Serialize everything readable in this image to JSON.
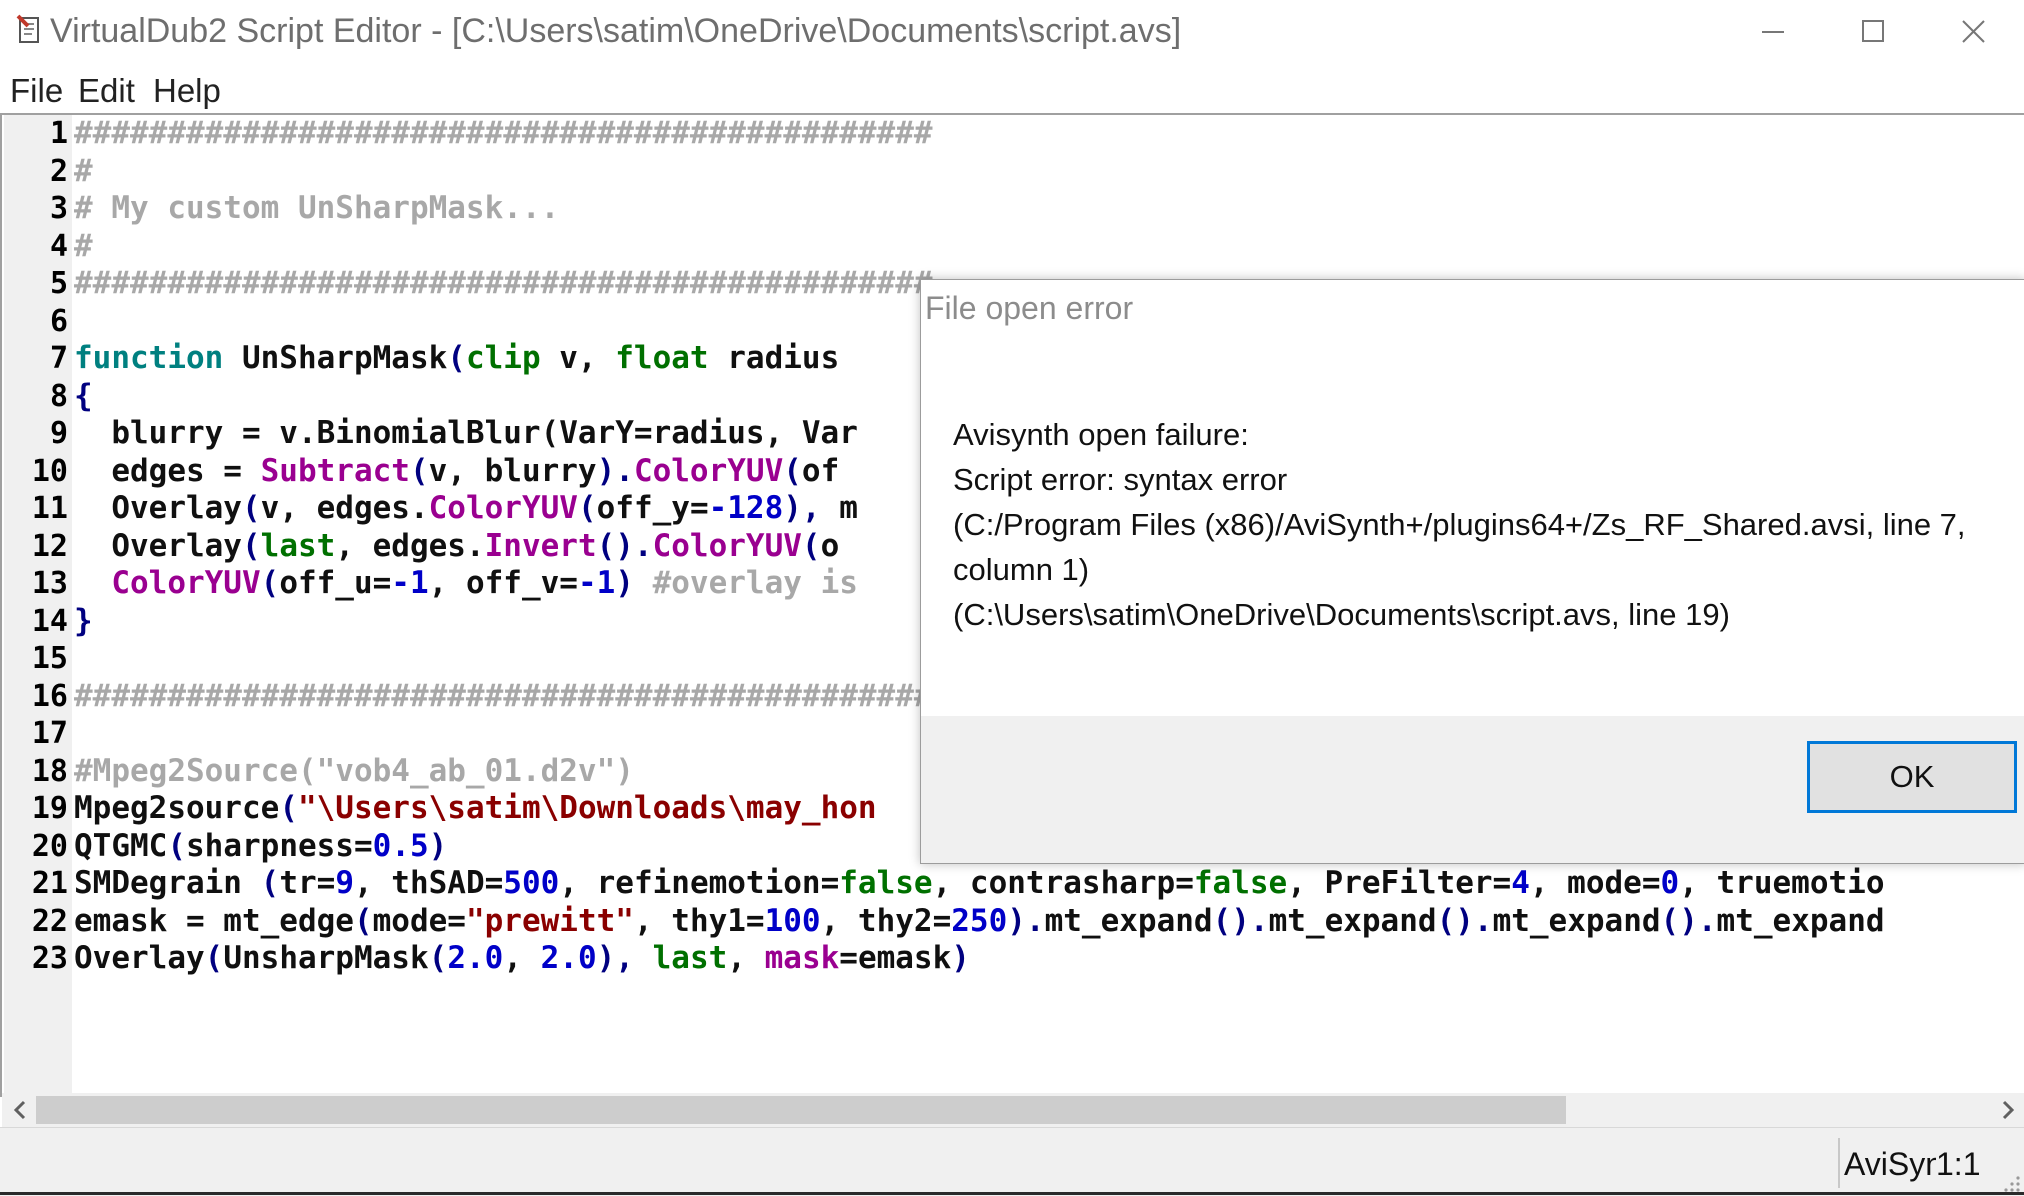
{
  "window": {
    "title": "VirtualDub2 Script Editor - [C:\\Users\\satim\\OneDrive\\Documents\\script.avs]"
  },
  "menu": {
    "items": [
      "File",
      "Edit",
      "Help"
    ]
  },
  "editor": {
    "lines": [
      {
        "n": "1",
        "tokens": [
          {
            "c": "com",
            "t": "##############################################"
          }
        ]
      },
      {
        "n": "2",
        "tokens": [
          {
            "c": "com",
            "t": "#"
          }
        ]
      },
      {
        "n": "3",
        "tokens": [
          {
            "c": "com",
            "t": "# My custom UnSharpMask..."
          }
        ]
      },
      {
        "n": "4",
        "tokens": [
          {
            "c": "com",
            "t": "#"
          }
        ]
      },
      {
        "n": "5",
        "tokens": [
          {
            "c": "com",
            "t": "##############################################"
          }
        ]
      },
      {
        "n": "6",
        "tokens": []
      },
      {
        "n": "7",
        "tokens": [
          {
            "c": "fn",
            "t": "function"
          },
          {
            "c": "pl",
            "t": " UnSharpMask"
          },
          {
            "c": "pun",
            "t": "("
          },
          {
            "c": "kw",
            "t": "clip"
          },
          {
            "c": "pl",
            "t": " v, "
          },
          {
            "c": "kw",
            "t": "float"
          },
          {
            "c": "pl",
            "t": " radius"
          }
        ]
      },
      {
        "n": "8",
        "tokens": [
          {
            "c": "pun",
            "t": "{"
          }
        ]
      },
      {
        "n": "9",
        "tokens": [
          {
            "c": "pl",
            "t": "  blurry = v.BinomialBlur(VarY=radius, Var"
          }
        ]
      },
      {
        "n": "10",
        "tokens": [
          {
            "c": "pl",
            "t": "  edges = "
          },
          {
            "c": "bi",
            "t": "Subtract"
          },
          {
            "c": "pun",
            "t": "("
          },
          {
            "c": "pl",
            "t": "v, blurry"
          },
          {
            "c": "pun",
            "t": ")."
          },
          {
            "c": "bi",
            "t": "ColorYUV"
          },
          {
            "c": "pun",
            "t": "("
          },
          {
            "c": "pl",
            "t": "of"
          }
        ]
      },
      {
        "n": "11",
        "tokens": [
          {
            "c": "pl",
            "t": "  Overlay"
          },
          {
            "c": "pun",
            "t": "("
          },
          {
            "c": "pl",
            "t": "v, edges."
          },
          {
            "c": "bi",
            "t": "ColorYUV"
          },
          {
            "c": "pun",
            "t": "("
          },
          {
            "c": "pl",
            "t": "off_y="
          },
          {
            "c": "num",
            "t": "-128"
          },
          {
            "c": "pun",
            "t": "),"
          },
          {
            "c": "pl",
            "t": " m"
          }
        ]
      },
      {
        "n": "12",
        "tokens": [
          {
            "c": "pl",
            "t": "  Overlay"
          },
          {
            "c": "pun",
            "t": "("
          },
          {
            "c": "kw",
            "t": "last"
          },
          {
            "c": "pl",
            "t": ", edges."
          },
          {
            "c": "bi",
            "t": "Invert"
          },
          {
            "c": "pun",
            "t": "()."
          },
          {
            "c": "bi",
            "t": "ColorYUV"
          },
          {
            "c": "pun",
            "t": "("
          },
          {
            "c": "pl",
            "t": "o"
          }
        ]
      },
      {
        "n": "13",
        "tokens": [
          {
            "c": "bi",
            "t": "  ColorYUV"
          },
          {
            "c": "pun",
            "t": "("
          },
          {
            "c": "pl",
            "t": "off_u="
          },
          {
            "c": "num",
            "t": "-1"
          },
          {
            "c": "pl",
            "t": ", off_v="
          },
          {
            "c": "num",
            "t": "-1"
          },
          {
            "c": "pun",
            "t": ")"
          },
          {
            "c": "com",
            "t": " #overlay is"
          }
        ]
      },
      {
        "n": "14",
        "tokens": [
          {
            "c": "pun",
            "t": "}"
          }
        ]
      },
      {
        "n": "15",
        "tokens": []
      },
      {
        "n": "16",
        "tokens": [
          {
            "c": "com",
            "t": "##############################################"
          }
        ]
      },
      {
        "n": "17",
        "tokens": []
      },
      {
        "n": "18",
        "tokens": [
          {
            "c": "com",
            "t": "#Mpeg2Source(\"vob4_ab_01.d2v\")"
          }
        ]
      },
      {
        "n": "19",
        "tokens": [
          {
            "c": "pl",
            "t": "Mpeg2source"
          },
          {
            "c": "pun",
            "t": "("
          },
          {
            "c": "str",
            "t": "\"\\Users\\satim\\Downloads\\may_hon"
          }
        ]
      },
      {
        "n": "20",
        "tokens": [
          {
            "c": "pl",
            "t": "QTGMC"
          },
          {
            "c": "pun",
            "t": "("
          },
          {
            "c": "pl",
            "t": "sharpness="
          },
          {
            "c": "num",
            "t": "0.5"
          },
          {
            "c": "pun",
            "t": ")"
          }
        ]
      },
      {
        "n": "21",
        "tokens": [
          {
            "c": "pl",
            "t": "SMDegrain "
          },
          {
            "c": "pun",
            "t": "("
          },
          {
            "c": "pl",
            "t": "tr="
          },
          {
            "c": "num",
            "t": "9"
          },
          {
            "c": "pl",
            "t": ", thSAD="
          },
          {
            "c": "num",
            "t": "500"
          },
          {
            "c": "pl",
            "t": ", refinemotion="
          },
          {
            "c": "kw",
            "t": "false"
          },
          {
            "c": "pl",
            "t": ", contrasharp="
          },
          {
            "c": "kw",
            "t": "false"
          },
          {
            "c": "pl",
            "t": ", PreFilter="
          },
          {
            "c": "num",
            "t": "4"
          },
          {
            "c": "pl",
            "t": ", mode="
          },
          {
            "c": "num",
            "t": "0"
          },
          {
            "c": "pl",
            "t": ", truemotio"
          }
        ]
      },
      {
        "n": "22",
        "tokens": [
          {
            "c": "pl",
            "t": "emask = mt_edge"
          },
          {
            "c": "pun",
            "t": "("
          },
          {
            "c": "pl",
            "t": "mode="
          },
          {
            "c": "str",
            "t": "\"prewitt\""
          },
          {
            "c": "pl",
            "t": ", thy1="
          },
          {
            "c": "num",
            "t": "100"
          },
          {
            "c": "pl",
            "t": ", thy2="
          },
          {
            "c": "num",
            "t": "250"
          },
          {
            "c": "pun",
            "t": ")."
          },
          {
            "c": "pl",
            "t": "mt_expand"
          },
          {
            "c": "pun",
            "t": "()."
          },
          {
            "c": "pl",
            "t": "mt_expand"
          },
          {
            "c": "pun",
            "t": "()."
          },
          {
            "c": "pl",
            "t": "mt_expand"
          },
          {
            "c": "pun",
            "t": "()."
          },
          {
            "c": "pl",
            "t": "mt_expand"
          }
        ]
      },
      {
        "n": "23",
        "tokens": [
          {
            "c": "pl",
            "t": "Overlay"
          },
          {
            "c": "pun",
            "t": "("
          },
          {
            "c": "pl",
            "t": "UnsharpMask"
          },
          {
            "c": "pun",
            "t": "("
          },
          {
            "c": "num",
            "t": "2.0"
          },
          {
            "c": "pl",
            "t": ", "
          },
          {
            "c": "num",
            "t": "2.0"
          },
          {
            "c": "pun",
            "t": "),"
          },
          {
            "c": "pl",
            "t": " "
          },
          {
            "c": "kw",
            "t": "last"
          },
          {
            "c": "pl",
            "t": ", "
          },
          {
            "c": "bi",
            "t": "mask"
          },
          {
            "c": "pl",
            "t": "=emask"
          },
          {
            "c": "pun",
            "t": ")"
          }
        ]
      }
    ]
  },
  "dialog": {
    "title": "File open error",
    "message_lines": [
      "Avisynth open failure:",
      "Script error: syntax error",
      "(C:/Program Files (x86)/AviSynth+/plugins64+/Zs_RF_Shared.avsi, line 7,",
      "column 1)",
      "(C:\\Users\\satim\\OneDrive\\Documents\\script.avs, line 19)"
    ],
    "ok_label": "OK"
  },
  "statusbar": {
    "language": "AviSynth",
    "position": "1:1"
  },
  "colors": {
    "comment": "#a8a8a8",
    "function_keyword": "#008080",
    "type_keyword": "#007000",
    "builtin": "#9a0090",
    "number": "#0000c8",
    "string": "#8a0000",
    "accent": "#0078d7"
  }
}
